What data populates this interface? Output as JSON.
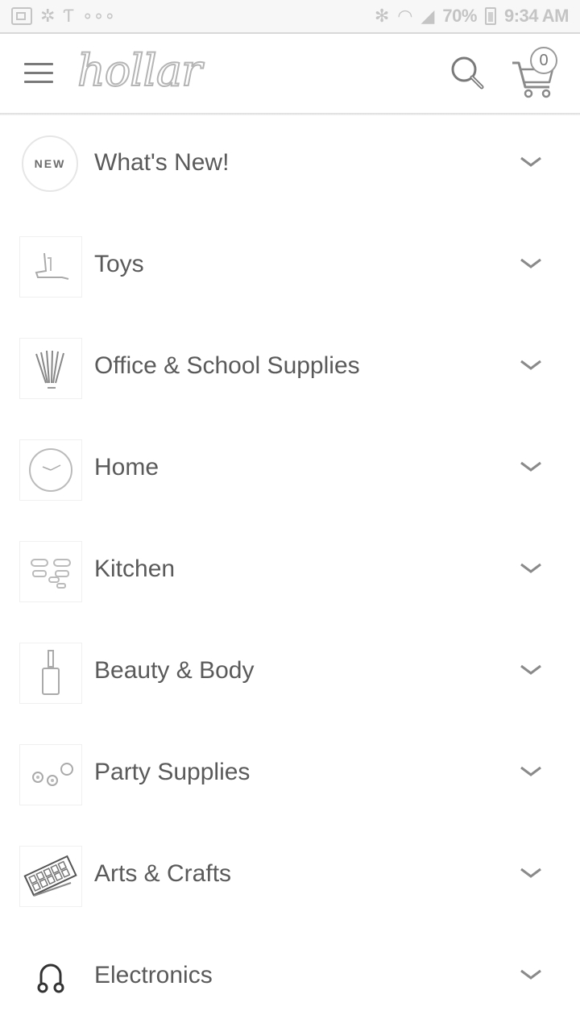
{
  "status_bar": {
    "battery_percent": "70%",
    "time": "9:34 AM",
    "left_icons": [
      "screen-icon",
      "pinwheel-icon",
      "carrier-icon",
      "more-dots-icon"
    ],
    "right_icons": [
      "bluetooth-icon",
      "wifi-icon",
      "signal-icon",
      "battery-icon"
    ]
  },
  "header": {
    "logo_text": "hollar",
    "cart_count": "0"
  },
  "categories": [
    {
      "label": "What's New!",
      "thumb_text": "NEW",
      "icon": "new-badge-icon"
    },
    {
      "label": "Toys",
      "icon": "toy-icon"
    },
    {
      "label": "Office & School Supplies",
      "icon": "pens-icon"
    },
    {
      "label": "Home",
      "icon": "clock-icon"
    },
    {
      "label": "Kitchen",
      "icon": "containers-icon"
    },
    {
      "label": "Beauty & Body",
      "icon": "nail-polish-icon"
    },
    {
      "label": "Party Supplies",
      "icon": "ornaments-icon"
    },
    {
      "label": "Arts & Crafts",
      "icon": "paint-palette-icon"
    },
    {
      "label": "Electronics",
      "icon": "headphones-icon"
    }
  ],
  "colors": {
    "text": "#5a5a5a",
    "icon_gray": "#9a9a9a",
    "background": "#ffffff"
  }
}
